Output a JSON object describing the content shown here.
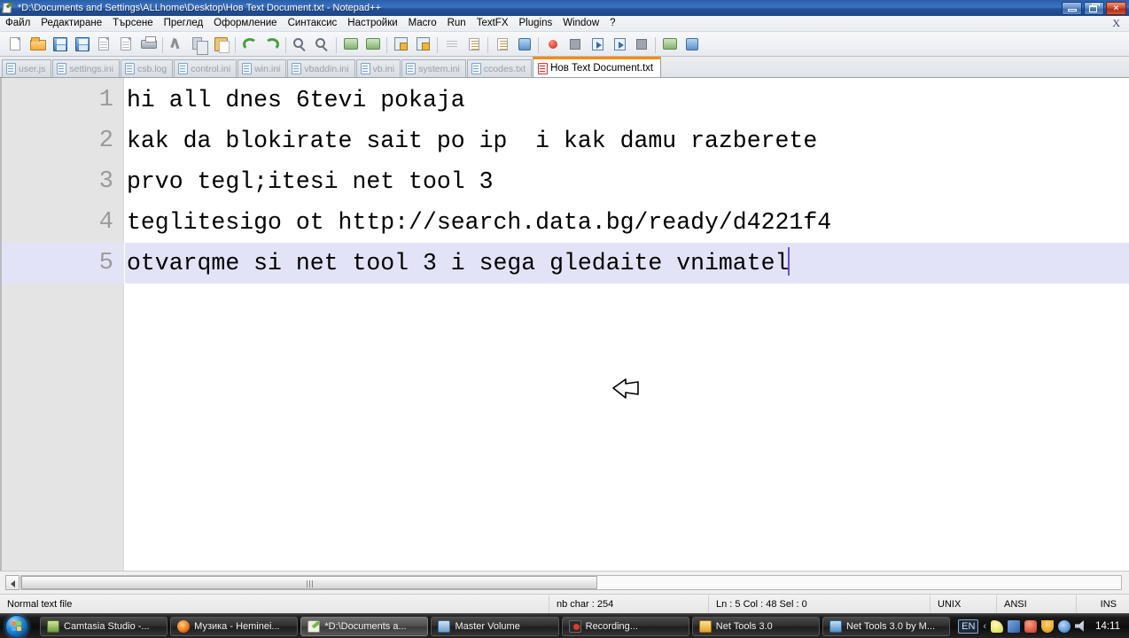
{
  "window": {
    "title": "*D:\\Documents and Settings\\ALLhome\\Desktop\\Нов Text Document.txt - Notepad++",
    "icon": "notepadpp-icon",
    "minimize_label": "–",
    "maximize_label": "❐",
    "close_label": "✕"
  },
  "menu": {
    "items": [
      {
        "label": "Файл"
      },
      {
        "label": "Редактиране"
      },
      {
        "label": "Търсене"
      },
      {
        "label": "Преглед"
      },
      {
        "label": "Оформление"
      },
      {
        "label": "Синтаксис"
      },
      {
        "label": "Настройки"
      },
      {
        "label": "Macro"
      },
      {
        "label": "Run"
      },
      {
        "label": "TextFX"
      },
      {
        "label": "Plugins"
      },
      {
        "label": "Window"
      },
      {
        "label": "?"
      }
    ],
    "close_document_label": "X"
  },
  "toolbar": {
    "buttons": [
      {
        "name": "new-file-icon"
      },
      {
        "name": "open-file-icon"
      },
      {
        "name": "save-icon"
      },
      {
        "name": "save-all-icon"
      },
      {
        "name": "close-file-icon"
      },
      {
        "name": "close-all-icon"
      },
      {
        "name": "print-icon"
      },
      {
        "name": "cut-icon"
      },
      {
        "name": "copy-icon"
      },
      {
        "name": "paste-icon"
      },
      {
        "name": "undo-icon"
      },
      {
        "name": "redo-icon"
      },
      {
        "name": "find-icon"
      },
      {
        "name": "replace-icon"
      },
      {
        "name": "zoom-in-icon"
      },
      {
        "name": "zoom-out-icon"
      },
      {
        "name": "sync-vertical-icon"
      },
      {
        "name": "sync-horizontal-icon"
      },
      {
        "name": "word-wrap-icon"
      },
      {
        "name": "show-all-chars-icon"
      },
      {
        "name": "indent-guide-icon"
      },
      {
        "name": "user-defined-dialog-icon"
      },
      {
        "name": "record-macro-icon"
      },
      {
        "name": "stop-recording-icon"
      },
      {
        "name": "play-macro-icon"
      },
      {
        "name": "run-macro-multiple-icon"
      },
      {
        "name": "block-icon"
      },
      {
        "name": "launch-firefox-icon"
      },
      {
        "name": "launch-ie-icon"
      }
    ]
  },
  "tabs": [
    {
      "label": "user.js",
      "active": false
    },
    {
      "label": "settings.ini",
      "active": false
    },
    {
      "label": "csb.log",
      "active": false
    },
    {
      "label": "control.ini",
      "active": false
    },
    {
      "label": "win.ini",
      "active": false
    },
    {
      "label": "vbaddin.ini",
      "active": false
    },
    {
      "label": "vb.ini",
      "active": false
    },
    {
      "label": "system.ini",
      "active": false
    },
    {
      "label": "ccodes.txt",
      "active": false
    },
    {
      "label": "Нов Text Document.txt",
      "active": true
    }
  ],
  "editor": {
    "lines": [
      {
        "number": "1",
        "text": "hi all dnes 6tevi pokaja",
        "current": false
      },
      {
        "number": "2",
        "text": "kak da blokirate sait po ip  i kak damu razberete",
        "current": false
      },
      {
        "number": "3",
        "text": "prvo tegl;itesi net tool 3",
        "current": false
      },
      {
        "number": "4",
        "text": "teglitesigo ot http://search.data.bg/ready/d4221f4",
        "current": false
      },
      {
        "number": "5",
        "text": "otvarqme si net tool 3 i sega gledaite vnimatel",
        "current": true
      }
    ],
    "current_line_highlight_color": "#e3e3f7",
    "caret_color": "#6a4fd8"
  },
  "statusbar": {
    "file_type": "Normal text file",
    "char_count": "nb char : 254",
    "position": "Ln : 5   Col : 48   Sel : 0",
    "eol": "UNIX",
    "encoding": "ANSI",
    "insert_mode": "INS"
  },
  "taskbar": {
    "start_label": "start-orb",
    "items": [
      {
        "label": "Camtasia Studio -...",
        "icon": "camtasia-icon",
        "active": false
      },
      {
        "label": "Музика - Heminei...",
        "icon": "firefox-icon",
        "active": false
      },
      {
        "label": "*D:\\Documents a...",
        "icon": "notepadpp-icon",
        "active": true
      },
      {
        "label": "Master Volume",
        "icon": "volume-icon",
        "active": false
      },
      {
        "label": "Recording...",
        "icon": "recording-icon",
        "active": false
      },
      {
        "label": "Net Tools 3.0",
        "icon": "nettools-icon",
        "active": false
      },
      {
        "label": "Net Tools 3.0 by M...",
        "icon": "nettools-blue-icon",
        "active": false
      }
    ],
    "language": "EN",
    "tray_chevron": "‹",
    "clock": "14:11"
  }
}
